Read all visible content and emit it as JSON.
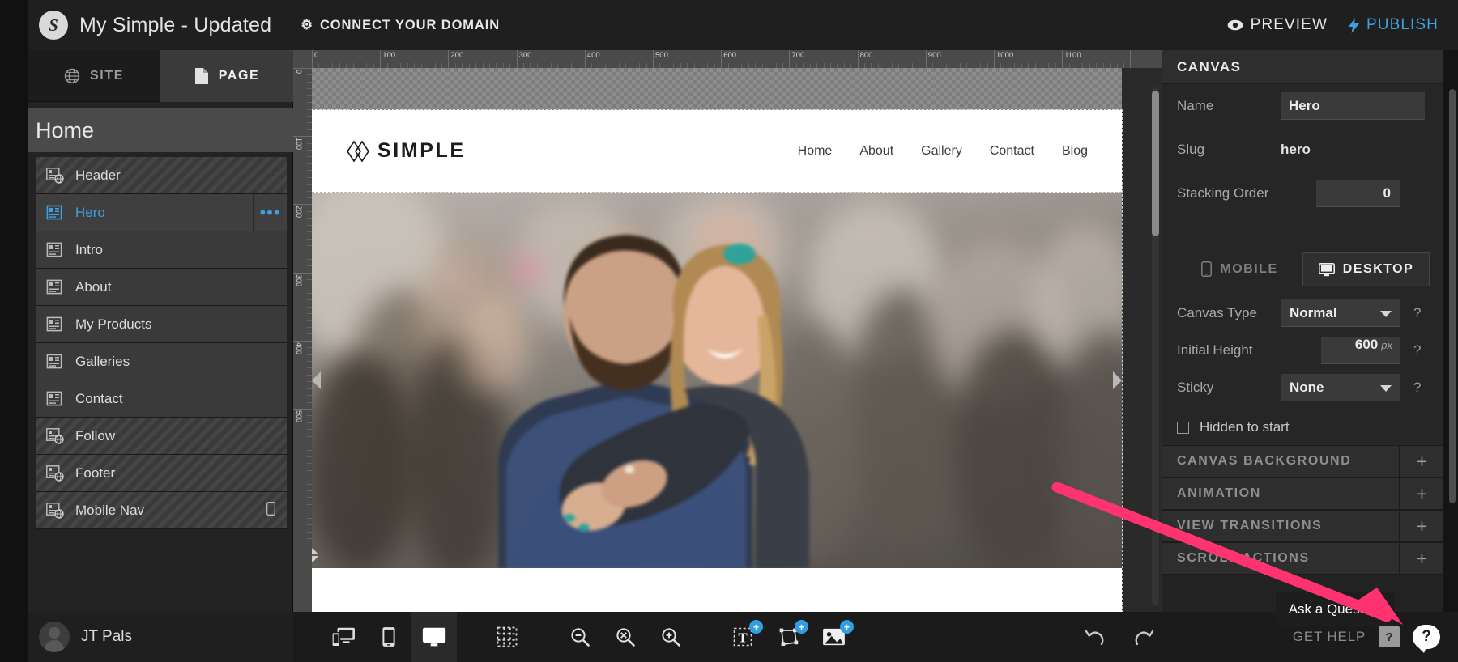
{
  "topbar": {
    "logo_glyph": "S",
    "site_title": "My Simple - Updated",
    "connect_domain": "CONNECT YOUR DOMAIN",
    "preview": "PREVIEW",
    "publish": "PUBLISH"
  },
  "sidebar": {
    "tabs": [
      {
        "label": "SITE",
        "icon": "globe-icon",
        "active": false
      },
      {
        "label": "PAGE",
        "icon": "page-icon",
        "active": true
      }
    ],
    "page_title": "Home",
    "layers": [
      {
        "label": "Header",
        "global": true,
        "selected": false,
        "mobile": false
      },
      {
        "label": "Hero",
        "global": false,
        "selected": true,
        "mobile": false
      },
      {
        "label": "Intro",
        "global": false,
        "selected": false,
        "mobile": false
      },
      {
        "label": "About",
        "global": false,
        "selected": false,
        "mobile": false
      },
      {
        "label": "My Products",
        "global": false,
        "selected": false,
        "mobile": false
      },
      {
        "label": "Galleries",
        "global": false,
        "selected": false,
        "mobile": false
      },
      {
        "label": "Contact",
        "global": false,
        "selected": false,
        "mobile": false
      },
      {
        "label": "Follow",
        "global": true,
        "selected": false,
        "mobile": false
      },
      {
        "label": "Footer",
        "global": true,
        "selected": false,
        "mobile": false
      },
      {
        "label": "Mobile Nav",
        "global": true,
        "selected": false,
        "mobile": true
      }
    ],
    "layer_menu_dots": "•••",
    "user_name": "JT Pals"
  },
  "canvas": {
    "ruler_unit": "px",
    "ruler_h_ticks": [
      0,
      100,
      200,
      300,
      400,
      500,
      600,
      700,
      800,
      900,
      1000,
      1100
    ],
    "ruler_v_ticks": [
      0,
      100,
      200,
      300,
      400,
      500
    ],
    "site": {
      "logo_text": "SIMPLE",
      "nav": [
        "Home",
        "About",
        "Gallery",
        "Contact",
        "Blog"
      ]
    }
  },
  "rightpanel": {
    "header": "CANVAS",
    "name_label": "Name",
    "name_value": "Hero",
    "slug_label": "Slug",
    "slug_value": "hero",
    "stacking_label": "Stacking Order",
    "stacking_value": "0",
    "device_tabs": [
      {
        "label": "MOBILE",
        "icon": "phone-icon",
        "active": false
      },
      {
        "label": "DESKTOP",
        "icon": "monitor-icon",
        "active": true
      }
    ],
    "canvas_type_label": "Canvas Type",
    "canvas_type_value": "Normal",
    "initial_height_label": "Initial Height",
    "initial_height_value": "600",
    "initial_height_unit": "px",
    "sticky_label": "Sticky",
    "sticky_value": "None",
    "hidden_label": "Hidden to start",
    "help_glyph": "?",
    "sections": [
      {
        "title": "CANVAS BACKGROUND",
        "toggle": "+"
      },
      {
        "title": "ANIMATION",
        "toggle": "+"
      },
      {
        "title": "VIEW TRANSITIONS",
        "toggle": "+"
      },
      {
        "title": "SCROLL ACTIONS",
        "toggle": "+"
      }
    ]
  },
  "bottombar": {
    "tools": [
      {
        "name": "responsive-view-icon",
        "badge": null,
        "active": false
      },
      {
        "name": "mobile-view-icon",
        "badge": null,
        "active": false
      },
      {
        "name": "desktop-view-icon",
        "badge": null,
        "active": true
      },
      {
        "name": "grid-icon",
        "badge": null,
        "active": false
      },
      {
        "name": "zoom-out-icon",
        "badge": null,
        "active": false
      },
      {
        "name": "zoom-reset-icon",
        "badge": null,
        "active": false
      },
      {
        "name": "zoom-in-icon",
        "badge": null,
        "active": false
      },
      {
        "name": "add-text-icon",
        "badge": "+",
        "active": false
      },
      {
        "name": "add-shape-icon",
        "badge": "+",
        "active": false
      },
      {
        "name": "add-image-icon",
        "badge": "+",
        "active": false
      }
    ],
    "undo": "undo-icon",
    "redo": "redo-icon",
    "get_help": "GET HELP",
    "help_square": "?",
    "chat_glyph": "?",
    "tooltip": "Ask a Question"
  },
  "colors": {
    "accent_blue": "#3fa0e0",
    "badge_blue": "#2f9fe0",
    "arrow_pink": "#ff3370",
    "panel_bg": "#232323",
    "topbar_bg": "#1f1f1f"
  }
}
